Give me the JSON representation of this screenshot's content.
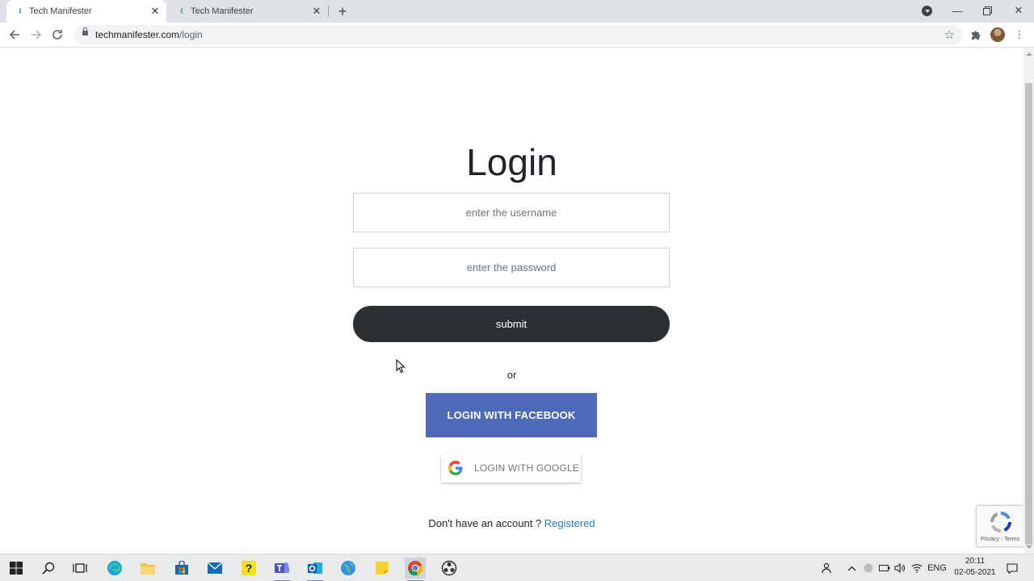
{
  "browser": {
    "tabs": [
      {
        "title": "Tech Manifester",
        "active": true
      },
      {
        "title": "Tech Manifester",
        "active": false
      }
    ],
    "url_host": "techmanifester.com",
    "url_path": "/login"
  },
  "login": {
    "title": "Login",
    "username_placeholder": "enter the username",
    "password_placeholder": "enter the password",
    "submit_label": "submit",
    "or_text": "or",
    "facebook_label": "LOGIN WITH FACEBOOK",
    "google_label": "LOGIN WITH GOOGLE",
    "signup_prompt": "Don't have an account ?",
    "signup_link": "Registered"
  },
  "recaptcha": {
    "text": "Privacy - Terms"
  },
  "taskbar": {
    "language": "ENG",
    "time": "20:11",
    "date": "02-05-2021"
  },
  "colors": {
    "submit_bg": "#2d3033",
    "facebook_bg": "#4c69ba",
    "link": "#2b7bbf",
    "tabbar_bg": "#dee1e6"
  },
  "icons": {
    "favicon": "download-arrow-icon",
    "tab_close": "close-icon",
    "new_tab": "plus-icon",
    "back": "arrow-left-icon",
    "forward": "arrow-right-icon",
    "reload": "reload-icon",
    "lock": "lock-icon",
    "bookmark": "star-icon",
    "extensions": "puzzle-icon",
    "menu": "kebab-menu-icon"
  }
}
